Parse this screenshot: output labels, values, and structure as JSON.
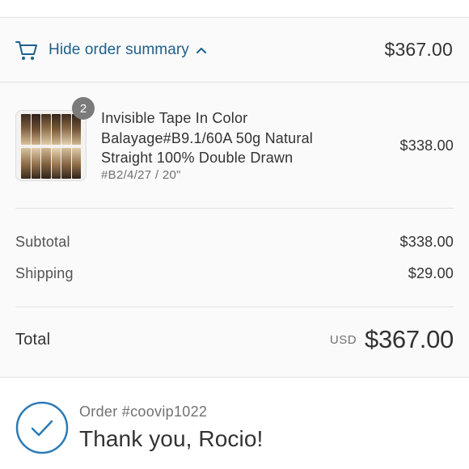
{
  "summary_toggle": {
    "label": "Hide order summary",
    "total": "$367.00",
    "icons": [
      "cart-icon",
      "chevron-up-icon"
    ]
  },
  "product": {
    "quantity": "2",
    "name": "Invisible Tape In Color Balayage#B9.1/60A 50g Natural Straight 100% Double Drawn",
    "variant": "#B2/4/27 / 20\"",
    "price": "$338.00"
  },
  "costs": {
    "subtotal_label": "Subtotal",
    "subtotal_value": "$338.00",
    "shipping_label": "Shipping",
    "shipping_value": "$29.00"
  },
  "total": {
    "label": "Total",
    "currency": "USD",
    "amount": "$367.00"
  },
  "confirmation": {
    "order_number": "Order #coovip1022",
    "title": "Thank you, Rocio!",
    "icon": "check-circle-icon"
  },
  "colors": {
    "accent": "#1f5f8b",
    "check": "#2c7bb6",
    "badge": "#7b7b7b",
    "panel_bg": "#fafafa"
  }
}
